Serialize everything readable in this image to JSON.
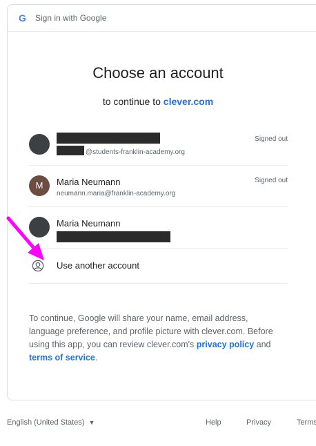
{
  "header": {
    "text": "Sign in with Google"
  },
  "title": "Choose an account",
  "subtitle": {
    "prefix": "to continue to",
    "site": "clever.com"
  },
  "accounts": [
    {
      "name": "",
      "email": "@students-franklin-academy.org",
      "status": "Signed out",
      "avatar_letter": ""
    },
    {
      "name": "Maria Neumann",
      "email": "neumann.maria@franklin-academy.org",
      "status": "Signed out",
      "avatar_letter": "M"
    },
    {
      "name": "Maria Neumann",
      "email": "",
      "status": "",
      "avatar_letter": ""
    }
  ],
  "use_another": "Use another account",
  "info": {
    "text": "To continue, Google will share your name, email address, language preference, and profile picture with clever.com. Before using this app, you can review clever.com's",
    "privacy": "privacy policy",
    "and": "and",
    "terms": "terms of service",
    "end": "."
  },
  "footer": {
    "language": "English (United States)",
    "help": "Help",
    "privacy": "Privacy",
    "terms": "Terms"
  },
  "colors": {
    "accent": "#1a73e8",
    "annotation": "#ff00ff"
  }
}
